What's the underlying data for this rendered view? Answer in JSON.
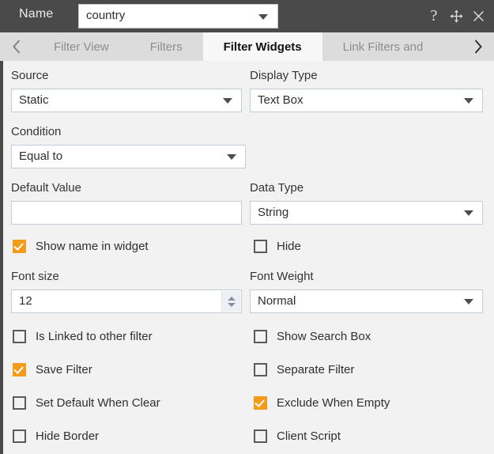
{
  "titlebar": {
    "name_label": "Name",
    "name_value": "country",
    "help_icon": "question-mark-icon",
    "move_icon": "move-arrows-icon",
    "close_icon": "close-x-icon"
  },
  "tabs": {
    "prev_icon": "chevron-left-icon",
    "next_icon": "chevron-right-icon",
    "items": [
      {
        "label": "Filter View",
        "active": false
      },
      {
        "label": "Filters",
        "active": false
      },
      {
        "label": "Filter Widgets",
        "active": true
      },
      {
        "label": "Link Filters and",
        "active": false
      }
    ]
  },
  "form": {
    "source": {
      "label": "Source",
      "value": "Static"
    },
    "display_type": {
      "label": "Display Type",
      "value": "Text Box"
    },
    "condition": {
      "label": "Condition",
      "value": "Equal to"
    },
    "default_value": {
      "label": "Default Value",
      "value": ""
    },
    "data_type": {
      "label": "Data Type",
      "value": "String"
    },
    "font_size": {
      "label": "Font size",
      "value": "12"
    },
    "font_weight": {
      "label": "Font Weight",
      "value": "Normal"
    },
    "checkboxes": [
      {
        "label": "Show name in widget",
        "checked": true
      },
      {
        "label": "Hide",
        "checked": false
      },
      {
        "label": "Is Linked to other filter",
        "checked": false
      },
      {
        "label": "Show Search Box",
        "checked": false
      },
      {
        "label": "Save Filter",
        "checked": true
      },
      {
        "label": "Separate Filter",
        "checked": false
      },
      {
        "label": "Set Default When Clear",
        "checked": false
      },
      {
        "label": "Exclude When Empty",
        "checked": true
      },
      {
        "label": "Hide Border",
        "checked": false
      },
      {
        "label": "Client Script",
        "checked": false
      }
    ]
  },
  "colors": {
    "titlebar_bg": "#4a4a4a",
    "accent_checked": "#f59b1a",
    "tab_active_bg": "#f7f7f7",
    "tabstrip_bg": "#dcdcdc",
    "body_bg": "#f2f2f2"
  }
}
